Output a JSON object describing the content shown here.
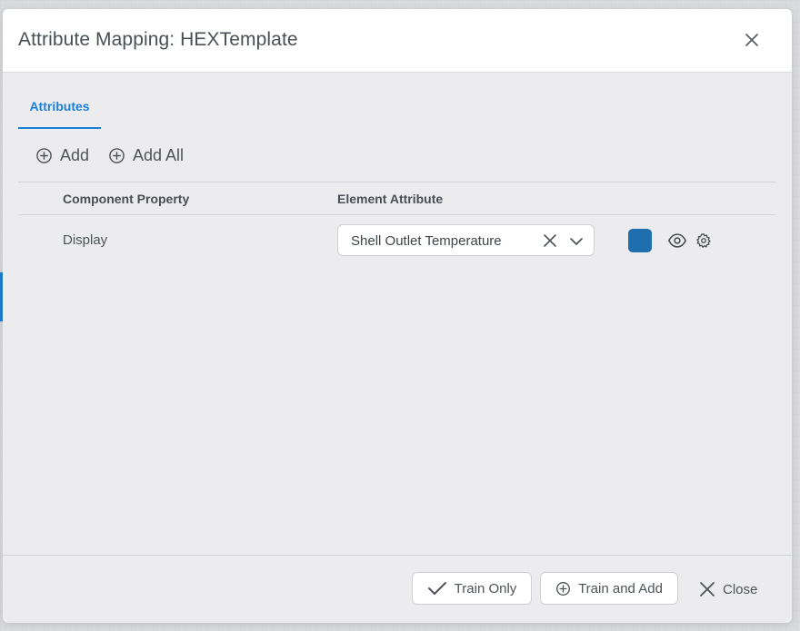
{
  "dialog": {
    "title": "Attribute Mapping: HEXTemplate"
  },
  "tabs": [
    {
      "label": "Attributes",
      "active": true
    }
  ],
  "actions": {
    "add_label": "Add",
    "add_all_label": "Add All"
  },
  "table": {
    "headers": [
      "Component Property",
      "Element Attribute"
    ],
    "rows": [
      {
        "property": "Display",
        "attribute": "Shell Outlet Temperature",
        "color": "#1f6fae"
      }
    ]
  },
  "footer": {
    "train_only_label": "Train Only",
    "train_and_add_label": "Train and Add",
    "close_label": "Close"
  },
  "icons": [
    "close-icon",
    "plus-circle-icon",
    "clear-icon",
    "chevron-down-icon",
    "eye-icon",
    "gear-icon",
    "check-icon"
  ],
  "colors": {
    "accent": "#1c7fd6",
    "swatch": "#1f6fae"
  }
}
